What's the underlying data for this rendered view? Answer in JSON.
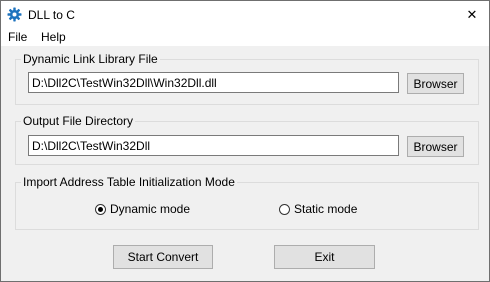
{
  "window": {
    "title": "DLL to C",
    "icon": "gear-icon",
    "close_glyph": "✕"
  },
  "menu": {
    "items": [
      "File",
      "Help"
    ]
  },
  "dll_group": {
    "label": "Dynamic Link Library File",
    "path_value": "D:\\Dll2C\\TestWin32Dll\\Win32Dll.dll",
    "browse_label": "Browser"
  },
  "output_group": {
    "label": "Output File Directory",
    "path_value": "D:\\Dll2C\\TestWin32Dll",
    "browse_label": "Browser"
  },
  "iat_group": {
    "label": "Import Address Table Initialization Mode",
    "options": [
      {
        "label": "Dynamic mode",
        "selected": true
      },
      {
        "label": "Static mode",
        "selected": false
      }
    ]
  },
  "actions": {
    "start_label": "Start Convert",
    "exit_label": "Exit"
  },
  "colors": {
    "window_bg": "#f0f0f0",
    "titlebar_bg": "#ffffff",
    "button_bg": "#e1e1e1",
    "icon_blue": "#1e73be"
  }
}
